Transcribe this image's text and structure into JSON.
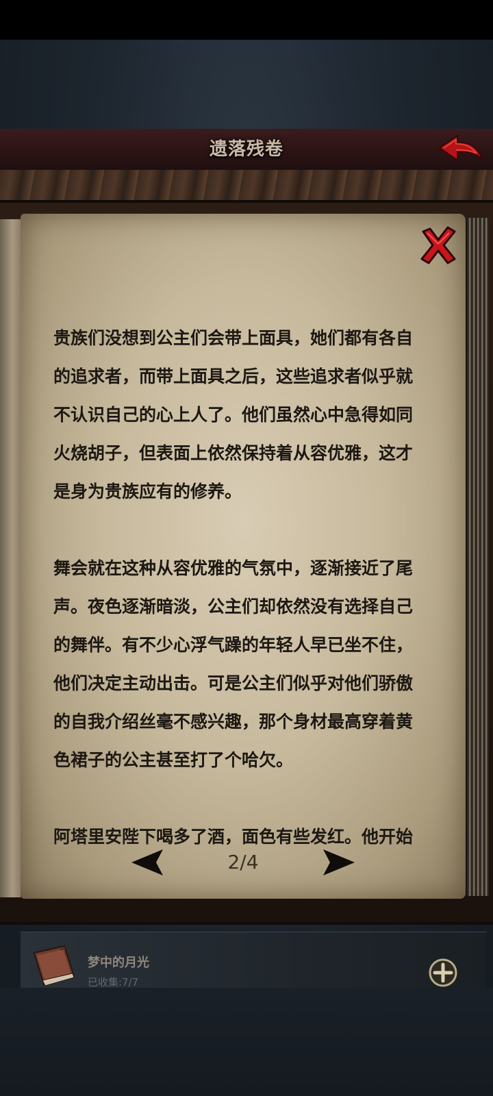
{
  "header": {
    "title": "遗落残卷",
    "back_icon": "back-arrow-icon"
  },
  "page": {
    "close_icon": "close-x-icon",
    "paragraphs": [
      "贵族们没想到公主们会带上面具，她们都有各自的追求者，而带上面具之后，这些追求者似乎就不认识自己的心上人了。他们虽然心中急得如同火烧胡子，但表面上依然保持着从容优雅，这才是身为贵族应有的修养。",
      "舞会就在这种从容优雅的气氛中，逐渐接近了尾声。夜色逐渐暗淡，公主们却依然没有选择自己的舞伴。有不少心浮气躁的年轻人早已坐不住，他们决定主动出击。可是公主们似乎对他们骄傲的自我介绍丝毫不感兴趣，那个身材最高穿着黄色裙子的公主甚至打了个哈欠。",
      "阿塔里安陛下喝多了酒，面色有些发红。他开始"
    ],
    "pager": {
      "indicator": "2/4",
      "current": 2,
      "total": 4
    }
  },
  "collection": {
    "title": "梦中的月光",
    "progress": "已收集:7/7",
    "icon": "book-icon",
    "add_icon": "plus-icon"
  },
  "colors": {
    "title_bar": "#2a1314",
    "accent_red": "#c8161b",
    "parchment": "#c7b99c",
    "text": "#1d1813"
  }
}
